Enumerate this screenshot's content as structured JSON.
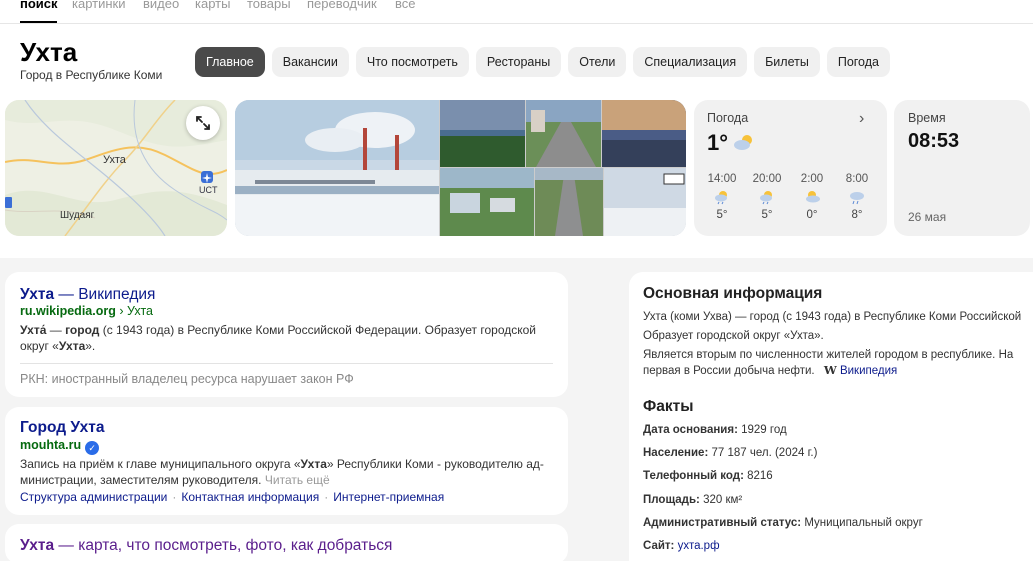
{
  "nav": {
    "tabs": [
      {
        "label": "поиск",
        "active": true
      },
      {
        "label": "картинки"
      },
      {
        "label": "видео"
      },
      {
        "label": "карты"
      },
      {
        "label": "товары"
      },
      {
        "label": "переводчик"
      },
      {
        "label": "все"
      }
    ]
  },
  "entity": {
    "title": "Ухта",
    "subtitle": "Город в Республике Коми",
    "chips": [
      "Главное",
      "Вакансии",
      "Что посмотреть",
      "Рестораны",
      "Отели",
      "Специализация",
      "Билеты",
      "Погода"
    ]
  },
  "map": {
    "city_label": "Ухта",
    "village_label": "Шудаяг",
    "airport_code": "UCT"
  },
  "weather": {
    "title": "Погода",
    "current_temp": "1°",
    "current_icon": "partly-cloudy-icon",
    "hours": [
      {
        "time": "14:00",
        "temp": "5°",
        "icon": "sun-rain-icon"
      },
      {
        "time": "20:00",
        "temp": "5°",
        "icon": "sun-rain-icon"
      },
      {
        "time": "2:00",
        "temp": "0°",
        "icon": "partly-cloudy-icon"
      },
      {
        "time": "8:00",
        "temp": "8°",
        "icon": "rain-icon"
      }
    ]
  },
  "time": {
    "label": "Время",
    "value": "08:53",
    "date": "26 мая"
  },
  "results": [
    {
      "title_bold": "Ухта",
      "title_rest": " — Википедия",
      "url_bold": "ru.wikipedia.org",
      "url_rest": " › Ухта",
      "snippet_parts": [
        "Ухта́",
        " — ",
        "город",
        " (с 1943 года) в Республике Коми Российской Федерации. Образует городской округ «",
        "Ухта",
        "»."
      ],
      "note": "РКН: иностранный владелец ресурса нарушает закон РФ"
    },
    {
      "title": "Город Ухта",
      "url": "mouhta.ru",
      "snippet_a": "Запись на приём к главе муниципального округа «",
      "snippet_bold": "Ухта",
      "snippet_b": "» Республики Коми - руководителю ад-",
      "snippet_line2": "министрации, заместителям руководителя.",
      "read_more": "Читать ещё",
      "links": [
        "Структура администрации",
        "Контактная информация",
        "Интернет-приемная"
      ]
    },
    {
      "title_bold": "Ухта",
      "title_rest": " — карта, что посмотреть, фото, как добраться"
    }
  ],
  "side": {
    "heading": "Основная информация",
    "line1": "Ухта (коми Ухва) — город (с 1943 года) в Республике Коми Российской",
    "line2": "Образует городской округ «Ухта».",
    "line3": "Является вторым по численности жителей городом в республике. На",
    "line4": "первая в России добыча нефти.",
    "wiki_label": "Википедия",
    "facts_heading": "Факты",
    "facts": [
      {
        "label": "Дата основания:",
        "value": "1929 год"
      },
      {
        "label": "Население:",
        "value": "77 187 чел. (2024 г.)"
      },
      {
        "label": "Телефонный код:",
        "value": "8216"
      },
      {
        "label": "Площадь:",
        "value": "320 км²"
      },
      {
        "label": "Административный статус:",
        "value": "Муниципальный округ"
      },
      {
        "label": "Сайт:",
        "value": "ухта.рф"
      }
    ]
  }
}
